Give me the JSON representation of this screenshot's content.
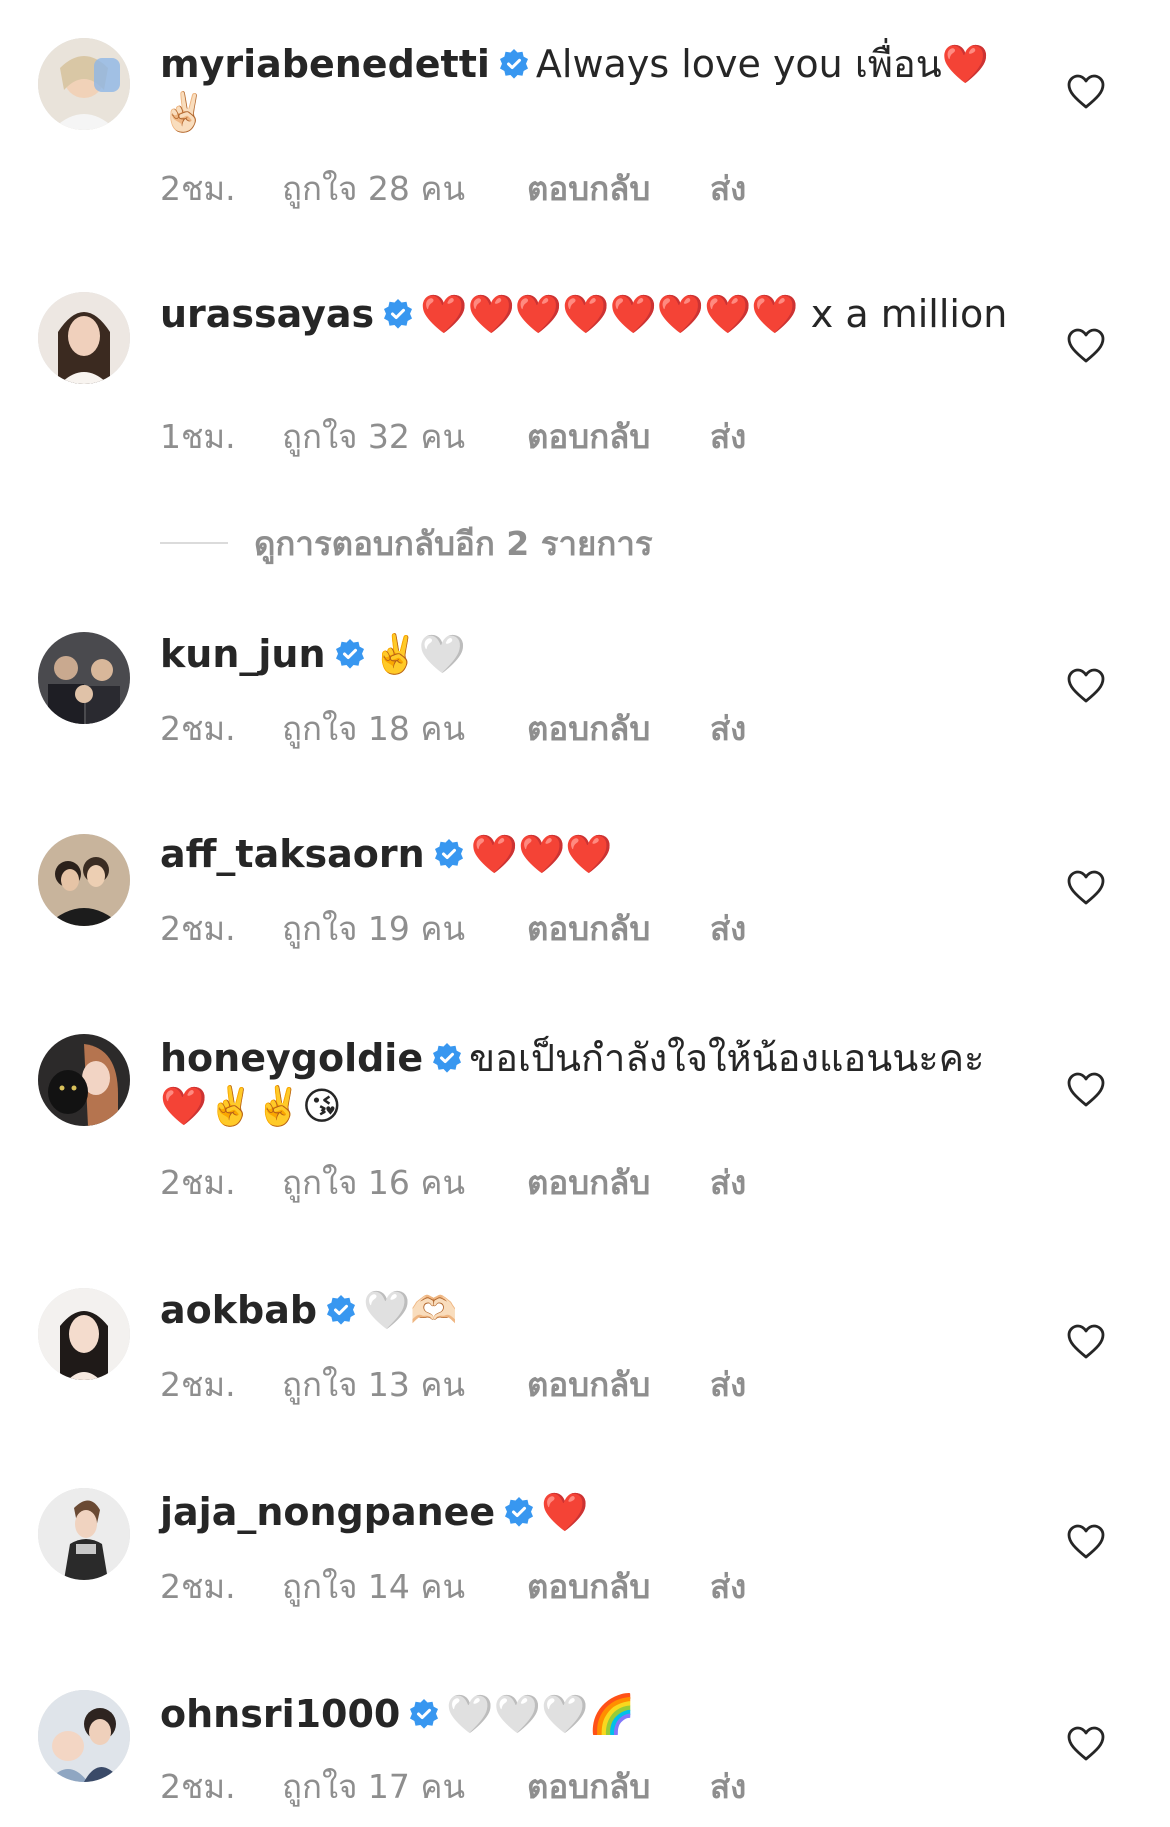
{
  "colors": {
    "text": "#262626",
    "secondary": "#8e8e8e",
    "verified": "#3897f0",
    "divider": "#dbdbdb"
  },
  "icons": {
    "verified": "verified-badge-icon",
    "like": "heart-outline-icon"
  },
  "comments": [
    {
      "username": "myriabenedetti",
      "verified": true,
      "text": "Always love you เพื่อน❤️✌🏻",
      "time": "2ชม.",
      "likes": "ถูกใจ 28 คน",
      "reply": "ตอบกลับ",
      "send": "ส่ง"
    },
    {
      "username": "urassayas",
      "verified": true,
      "text": "❤️❤️❤️❤️❤️❤️❤️❤️ x a million",
      "time": "1ชม.",
      "likes": "ถูกใจ 32 คน",
      "reply": "ตอบกลับ",
      "send": "ส่ง"
    },
    {
      "username": "kun_jun",
      "verified": true,
      "text": "✌️🤍",
      "time": "2ชม.",
      "likes": "ถูกใจ 18 คน",
      "reply": "ตอบกลับ",
      "send": "ส่ง"
    },
    {
      "username": "aff_taksaorn",
      "verified": true,
      "text": "❤️❤️❤️",
      "time": "2ชม.",
      "likes": "ถูกใจ 19 คน",
      "reply": "ตอบกลับ",
      "send": "ส่ง"
    },
    {
      "username": "honeygoldie",
      "verified": true,
      "text": "ขอเป็นกำลังใจให้น้องแอนนะคะ❤️✌️✌️😘",
      "time": "2ชม.",
      "likes": "ถูกใจ 16 คน",
      "reply": "ตอบกลับ",
      "send": "ส่ง"
    },
    {
      "username": "aokbab",
      "verified": true,
      "text": "🤍🫶🏻",
      "time": "2ชม.",
      "likes": "ถูกใจ 13 คน",
      "reply": "ตอบกลับ",
      "send": "ส่ง"
    },
    {
      "username": "jaja_nongpanee",
      "verified": true,
      "text": "❤️",
      "time": "2ชม.",
      "likes": "ถูกใจ 14 คน",
      "reply": "ตอบกลับ",
      "send": "ส่ง"
    },
    {
      "username": "ohnsri1000",
      "verified": true,
      "text": "🤍🤍🤍🌈",
      "time": "2ชม.",
      "likes": "ถูกใจ 17 คน",
      "reply": "ตอบกลับ",
      "send": "ส่ง"
    }
  ],
  "view_more_replies": "ดูการตอบกลับอีก 2 รายการ"
}
